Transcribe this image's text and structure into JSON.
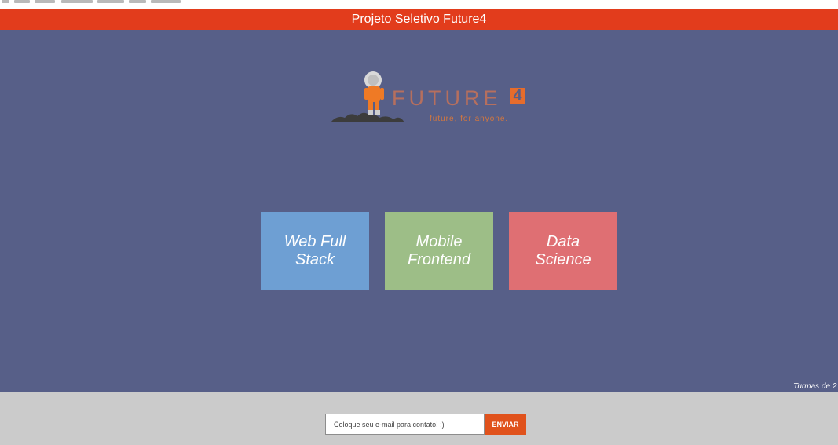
{
  "header": {
    "title": "Projeto Seletivo Future4"
  },
  "logo": {
    "wordmark": "FUTURE",
    "number": "4",
    "tagline": "future, for anyone."
  },
  "courses": [
    {
      "label": "Web Full Stack"
    },
    {
      "label": "Mobile Frontend"
    },
    {
      "label": "Data Science"
    }
  ],
  "side_note": "Turmas de 2",
  "contact": {
    "placeholder": "Coloque seu e-mail para contato! :)",
    "button_label": "ENVIAR"
  },
  "colors": {
    "header": "#e23c1c",
    "main_background": "#575f88",
    "web_tile": "#6e9fd3",
    "mobile_tile": "#9dbe87",
    "data_tile": "#df6f73",
    "footer": "#cbcbcb",
    "button": "#e0521c"
  }
}
